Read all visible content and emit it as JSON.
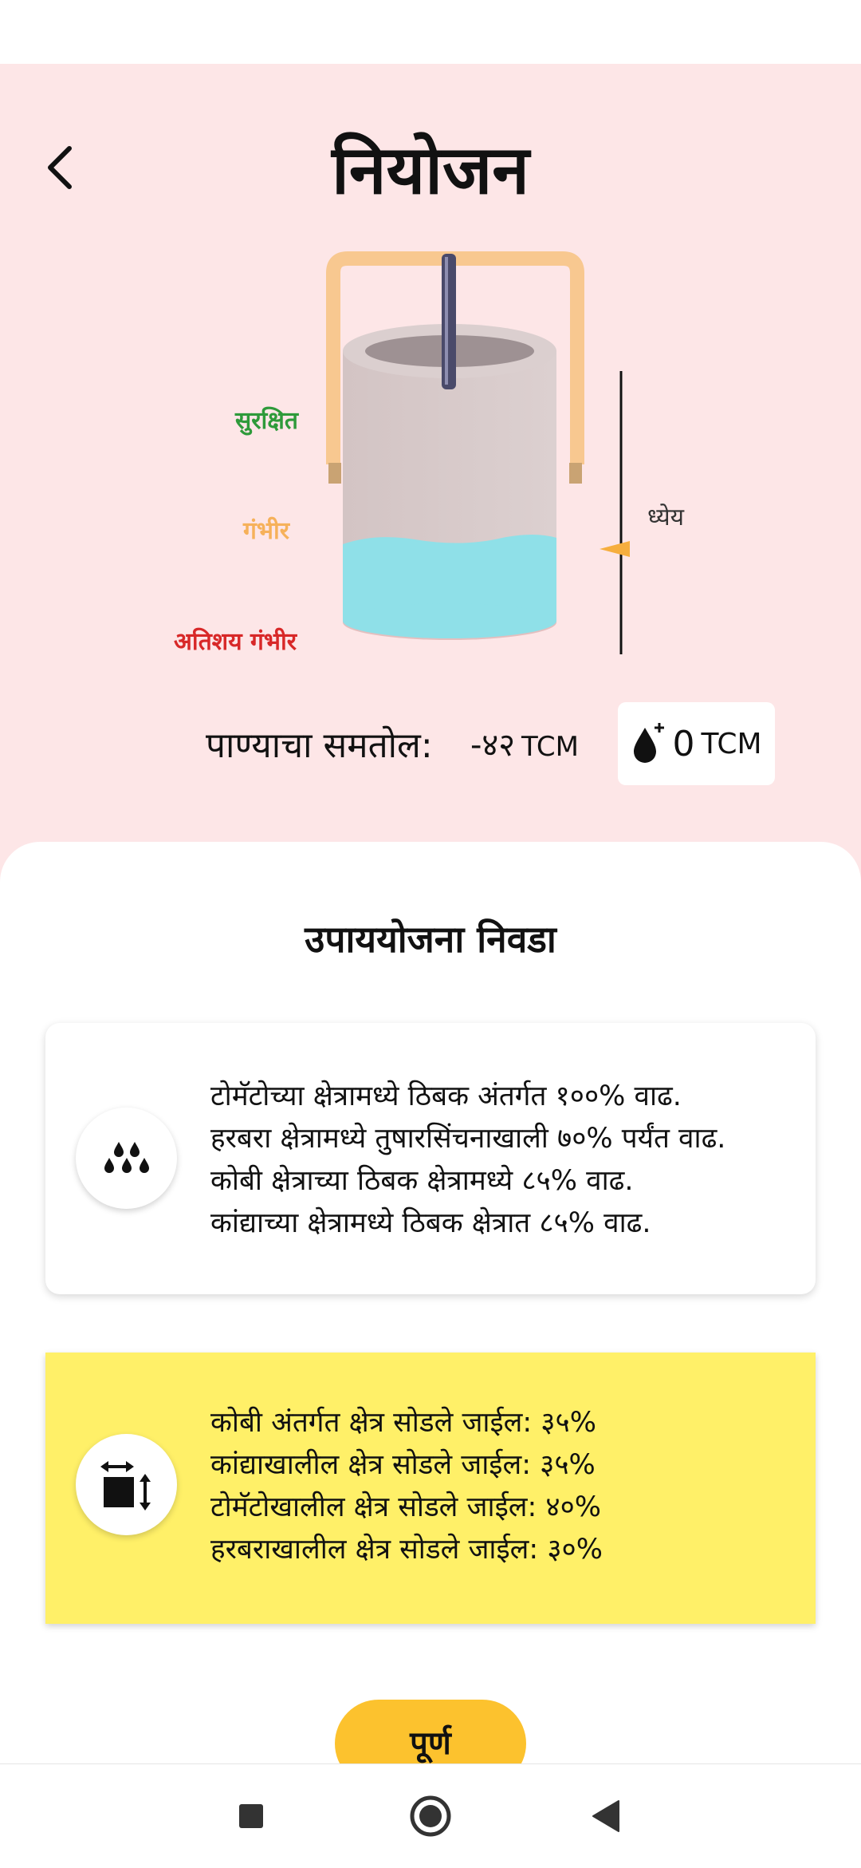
{
  "header": {
    "title": "नियोजन"
  },
  "tank": {
    "level_labels": {
      "safe": "सुरक्षित",
      "serious": "गंभीर",
      "extreme": "अतिशय गंभीर"
    },
    "goal_label": "ध्येय",
    "colors": {
      "safe": "#2e9a3a",
      "serious": "#f6b15a",
      "extreme": "#d82828",
      "water": "#8fe0e8",
      "handle": "#f8c890"
    }
  },
  "balance": {
    "label": "पाण्याचा समतोल:",
    "value": "-४२",
    "unit": "TCM",
    "button_value": "0",
    "button_unit": "TCM"
  },
  "options": {
    "title": "उपाययोजना निवडा",
    "cards": [
      {
        "icon": "drip-irrigation-icon",
        "lines": [
          "टोमॅटोच्या क्षेत्रामध्ये ठिबक अंतर्गत १००% वाढ.",
          "हरबरा क्षेत्रामध्ये तुषारसिंचनाखाली ७०% पर्यंत वाढ.",
          "कोबी क्षेत्राच्या ठिबक क्षेत्रामध्ये ८५% वाढ.",
          "कांद्याच्या क्षेत्रामध्ये ठिबक क्षेत्रात ८५% वाढ."
        ]
      },
      {
        "icon": "area-resize-icon",
        "background": "#fff068",
        "lines": [
          "कोबी अंतर्गत क्षेत्र सोडले जाईल: ३५%",
          "कांद्याखालील क्षेत्र सोडले जाईल: ३५%",
          "टोमॅटोखालील क्षेत्र सोडले जाईल: ४०%",
          "हरबराखालील क्षेत्र सोडले जाईल: ३०%"
        ]
      }
    ]
  },
  "done_button": {
    "label": "पूर्ण",
    "color": "#fcc22e"
  },
  "nav": {
    "recents": "square-icon",
    "home": "circle-icon",
    "back": "triangle-back-icon"
  }
}
